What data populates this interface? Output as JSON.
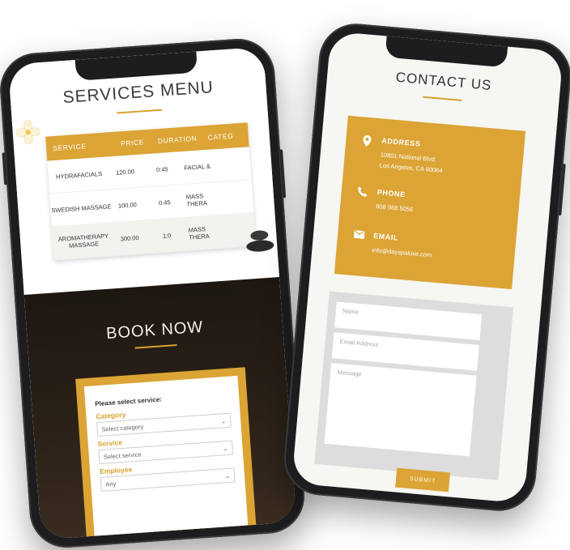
{
  "services": {
    "title": "SERVICES MENU",
    "columns": [
      "SERVICE",
      "PRICE",
      "DURATION",
      "CATEG"
    ],
    "rows": [
      {
        "service": "HYDRAFACIALS",
        "price": "120.00",
        "duration": "0:45",
        "category": "FACIAL &"
      },
      {
        "service": "SWEDISH MASSAGE",
        "price": "100.00",
        "duration": "0:45",
        "category": "MASS THERA"
      },
      {
        "service": "AROMATHERAPY MASSAGE",
        "price": "300.00",
        "duration": "1:0",
        "category": "MASS THERA"
      }
    ]
  },
  "booking": {
    "title": "BOOK NOW",
    "prompt": "Please select service:",
    "category_label": "Category",
    "category_value": "Select category",
    "service_label": "Service",
    "service_value": "Select service",
    "employee_label": "Employee",
    "employee_value": "Any"
  },
  "contact": {
    "title": "CONTACT US",
    "address_label": "ADDRESS",
    "address_line1": "10801 National Blvd,",
    "address_line2": "Los Angeles, CA 90064",
    "phone_label": "PHONE",
    "phone_value": "808 988 5056",
    "email_label": "EMAIL",
    "email_value": "info@dayspaluxe.com",
    "name_placeholder": "Name",
    "email_placeholder": "Email Address",
    "message_placeholder": "Message",
    "submit_label": "SUBMIT"
  },
  "colors": {
    "accent": "#dba435",
    "dark": "#1d1d1f"
  },
  "icons": [
    "location-pin-icon",
    "phone-icon",
    "envelope-icon",
    "chevron-down-icon"
  ]
}
